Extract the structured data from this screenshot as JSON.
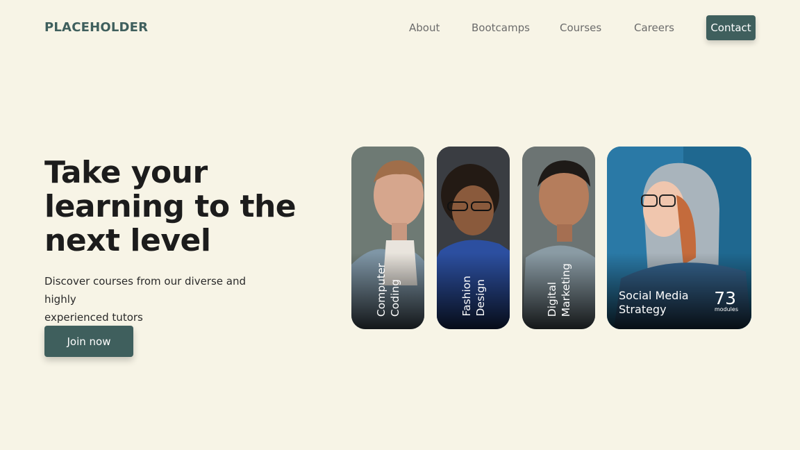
{
  "header": {
    "logo": "PLACEHOLDER",
    "nav": [
      {
        "label": "About"
      },
      {
        "label": "Bootcamps"
      },
      {
        "label": "Courses"
      },
      {
        "label": "Careers"
      }
    ],
    "contact_label": "Contact"
  },
  "hero": {
    "headline_line1": "Take your",
    "headline_line2": "learning to the",
    "headline_line3": "next level",
    "subtext_line1": "Discover courses from our diverse and highly",
    "subtext_line2": "experienced tutors",
    "cta_label": "Join now"
  },
  "courses": [
    {
      "title": "Computer\nCoding"
    },
    {
      "title": "Fashion\nDesign"
    },
    {
      "title": "Digital\nMarketing"
    },
    {
      "title": "Social Media\nStrategy",
      "modules_count": "73",
      "modules_label": "modules"
    }
  ],
  "colors": {
    "background": "#f7f4e6",
    "accent": "#3f5f5d"
  }
}
